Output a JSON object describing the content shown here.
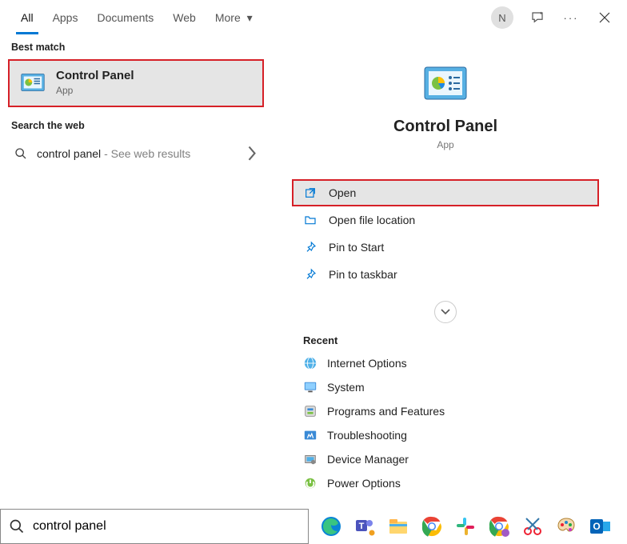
{
  "header": {
    "tabs": [
      {
        "label": "All",
        "active": true
      },
      {
        "label": "Apps",
        "active": false
      },
      {
        "label": "Documents",
        "active": false
      },
      {
        "label": "Web",
        "active": false
      },
      {
        "label": "More",
        "active": false,
        "hasDropdown": true
      }
    ],
    "avatarLetter": "N"
  },
  "left": {
    "bestMatchLabel": "Best match",
    "bestMatch": {
      "title": "Control Panel",
      "subtitle": "App"
    },
    "searchWebLabel": "Search the web",
    "webResult": {
      "query": "control panel",
      "hint": "See web results"
    }
  },
  "detail": {
    "title": "Control Panel",
    "subtitle": "App"
  },
  "actions": [
    {
      "label": "Open",
      "icon": "open-icon",
      "highlight": true
    },
    {
      "label": "Open file location",
      "icon": "folder-icon",
      "highlight": false
    },
    {
      "label": "Pin to Start",
      "icon": "pin-icon",
      "highlight": false
    },
    {
      "label": "Pin to taskbar",
      "icon": "pin-icon",
      "highlight": false
    }
  ],
  "recent": {
    "label": "Recent",
    "items": [
      {
        "label": "Internet Options",
        "icon": "internet-icon"
      },
      {
        "label": "System",
        "icon": "system-icon"
      },
      {
        "label": "Programs and Features",
        "icon": "programs-icon"
      },
      {
        "label": "Troubleshooting",
        "icon": "troubleshoot-icon"
      },
      {
        "label": "Device Manager",
        "icon": "device-icon"
      },
      {
        "label": "Power Options",
        "icon": "power-icon"
      }
    ]
  },
  "search": {
    "value": "control panel"
  }
}
